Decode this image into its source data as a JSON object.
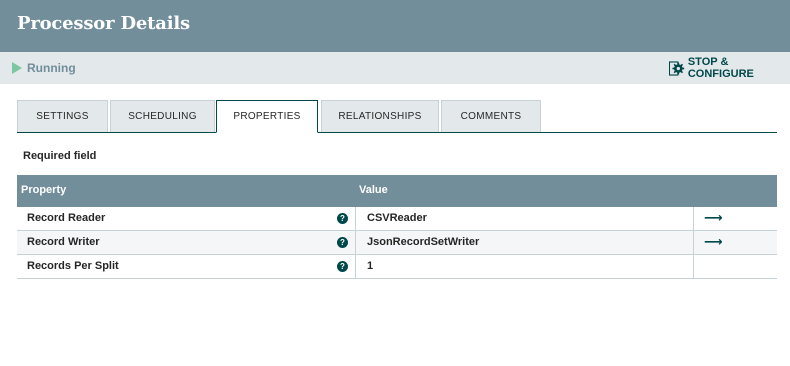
{
  "header": {
    "title": "Processor Details"
  },
  "status": {
    "state": "Running",
    "stop_configure_label": "STOP & CONFIGURE"
  },
  "tabs": [
    {
      "label": "SETTINGS"
    },
    {
      "label": "SCHEDULING"
    },
    {
      "label": "PROPERTIES",
      "active": true
    },
    {
      "label": "RELATIONSHIPS"
    },
    {
      "label": "COMMENTS"
    }
  ],
  "required_note": "Required field",
  "table": {
    "headers": {
      "property": "Property",
      "value": "Value"
    },
    "rows": [
      {
        "property": "Record Reader",
        "value": "CSVReader",
        "has_goto": true
      },
      {
        "property": "Record Writer",
        "value": "JsonRecordSetWriter",
        "has_goto": true
      },
      {
        "property": "Records Per Split",
        "value": "1",
        "has_goto": false
      }
    ]
  },
  "colors": {
    "header": "#728e9b",
    "statusbar": "#e3e8eb",
    "running": "#7dc7a0",
    "accent": "#004849"
  }
}
